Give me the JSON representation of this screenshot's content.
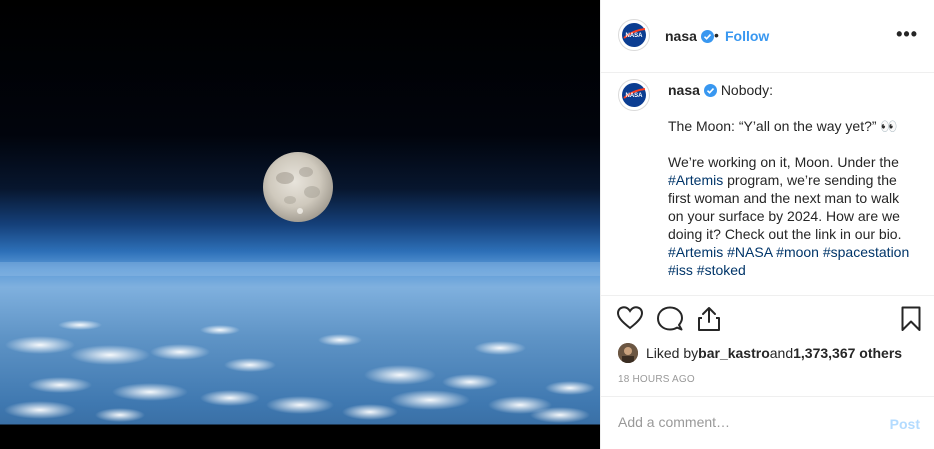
{
  "post": {
    "username": "nasa",
    "header_separator": "•",
    "follow_label": "Follow",
    "more_label": "•••",
    "caption": {
      "username": "nasa",
      "line1": "Nobody:",
      "line2": "The Moon: “Y’all on the way yet?” 👀",
      "line3_a": "We’re working on it, Moon. Under the ",
      "line3_tag": "#Artemis",
      "line3_b": " program, we’re sending the first woman and the next man to walk on your surface by 2024. How are we doing it? Check out the link in our bio. ",
      "tags_row1": [
        "#Artemis",
        "#NASA",
        "#moon"
      ],
      "tags_row2": [
        "#spacestation",
        "#iss",
        "#stoked"
      ]
    },
    "likes": {
      "prefix": "Liked by ",
      "user": "bar_kastro",
      "mid": " and ",
      "count": "1,373,367 others"
    },
    "timestamp": "18 HOURS AGO",
    "comment_placeholder": "Add a comment…",
    "post_label": "Post"
  },
  "colors": {
    "link": "#3897f0",
    "hashtag": "#003569",
    "post_disabled": "#b3dbff"
  },
  "icons": [
    "nasa-logo-icon",
    "verified-icon",
    "heart-icon",
    "comment-icon",
    "share-icon",
    "bookmark-icon"
  ]
}
